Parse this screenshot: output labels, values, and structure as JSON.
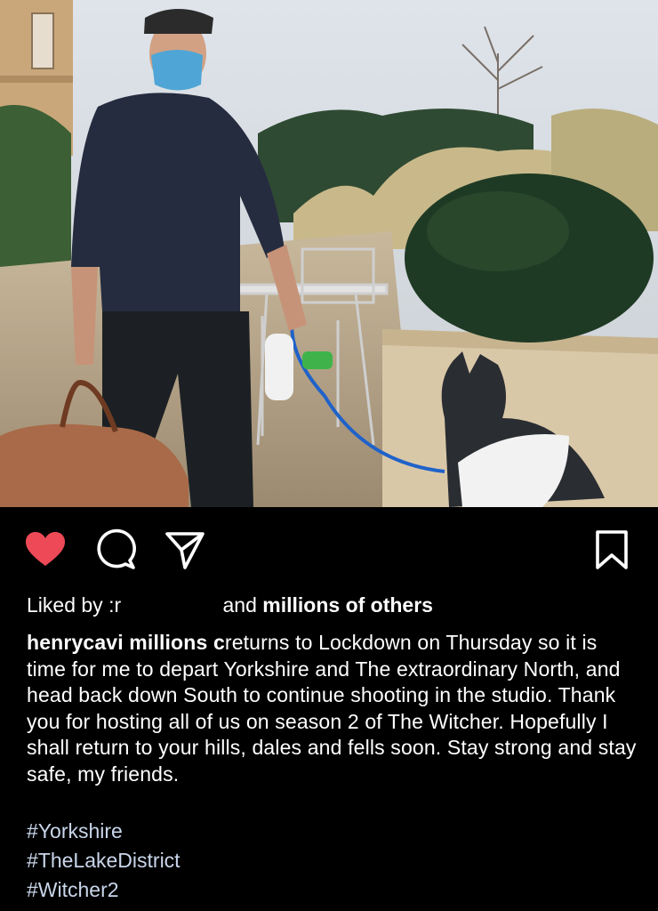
{
  "post": {
    "image_alt": "Man in a cap and face mask walking a dog on a leash beside a hedge, holding a brown leather bag",
    "colors": {
      "heart": "#ed4956",
      "background": "#000000",
      "text": "#ffffff",
      "hashtag": "#c9d6ea"
    }
  },
  "actions": {
    "like_icon": "heart-filled-icon",
    "comment_icon": "comment-bubble-icon",
    "share_icon": "paper-plane-icon",
    "save_icon": "bookmark-icon"
  },
  "likes": {
    "prefix": "Liked by",
    "partial_user": ":r",
    "and": "and",
    "others": "millions of others"
  },
  "caption": {
    "username": "henrycavi",
    "overlay": "millions c",
    "text": "returns to Lockdown on Thursday so it is time for me to depart Yorkshire and The extraordinary North, and head back down South to continue shooting in the studio. Thank you for hosting all of us on season 2 of The Witcher. Hopefully I shall return to your hills, dales and fells soon. Stay strong and stay safe, my friends.",
    "hashtags": [
      "#Yorkshire",
      "#TheLakeDistrict",
      "#Witcher2"
    ]
  }
}
